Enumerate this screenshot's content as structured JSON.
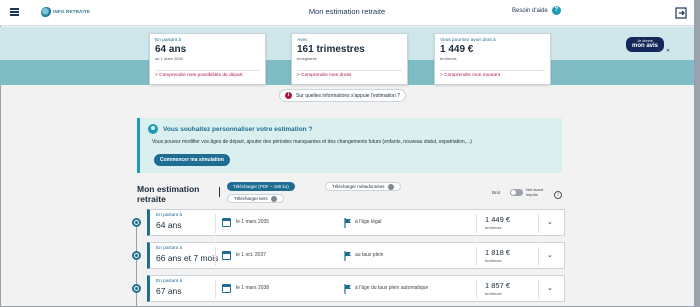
{
  "header": {
    "logo_text": "INFO RETRAITE",
    "title": "Mon estimation retraite",
    "help_label": "Besoin d'aide"
  },
  "summary": [
    {
      "pre": "En partant à",
      "value": "64 ans",
      "sub": "au 1 mars 2035",
      "link": "> Comprendre mes possibilités de départ"
    },
    {
      "pre": "Avec",
      "value": "161 trimestres",
      "sub": "enregistrés",
      "link": "> Comprendre mes droits"
    },
    {
      "pre": "Vous pourriez avoir droit à",
      "value": "1 449 €",
      "sub": "brut/mois",
      "link": "> Comprendre mon montant"
    }
  ],
  "badge": {
    "line1": "Je donne",
    "line2": "mon avis",
    "close": "✕"
  },
  "info_pill": {
    "label": "Sur quelles informations s'appuie l'estimation ?"
  },
  "personalize": {
    "title": "Vous souhaitez personnaliser votre estimation ?",
    "text": "Vous pouvez modifier vos âges de départ, ajouter des périodes manquantes et des changements futurs (enfants, nouveau statut, expatriation,...)",
    "button": "Commencer ma simulation"
  },
  "estimation": {
    "title": "Mon estimation retraite",
    "download_pdf": "Télécharger (PDF – 180 ko)",
    "download_meta": "Télécharger métadonnées",
    "download_tiers": "Télécharger tiers",
    "toggle_left": "Brut",
    "toggle_right": "Net avant impôts",
    "info": "i"
  },
  "scenarios": [
    {
      "pre": "En partant à",
      "age": "64 ans",
      "date": "le 1 mars 2035",
      "condition": "à l'âge légal",
      "amount": "1 449 €",
      "unit": "brut/mois"
    },
    {
      "pre": "En partant à",
      "age": "66 ans et 7 mois",
      "date": "le 1 oct. 2037",
      "condition": "au taux plein",
      "amount": "1 818 €",
      "unit": "brut/mois"
    },
    {
      "pre": "En partant à",
      "age": "67 ans",
      "date": "le 1 mars 2038",
      "condition": "à l'âge du taux plein automatique",
      "amount": "1 857 €",
      "unit": "brut/mois"
    }
  ],
  "colors": {
    "accent": "#1e6e93",
    "link": "#b0173c",
    "band": "#7fbcc4"
  }
}
